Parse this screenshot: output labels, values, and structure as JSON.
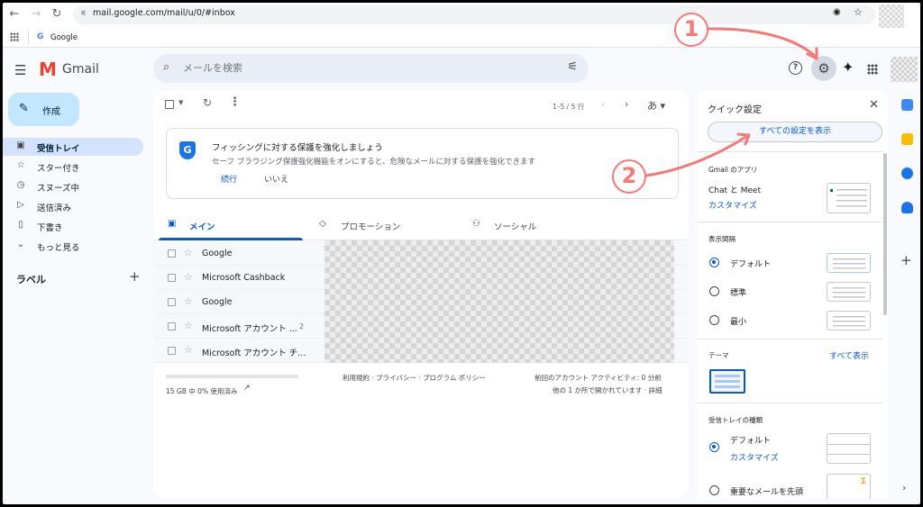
{
  "browser": {
    "url": "mail.google.com/mail/u/0/#inbox",
    "bookmark_label": "Google",
    "bookmark_icon_letter": "G"
  },
  "header": {
    "logo_letter": "M",
    "app_name": "Gmail",
    "search_placeholder": "メールを検索"
  },
  "nav": {
    "compose_label": "作成",
    "items": [
      {
        "label": "受信トレイ",
        "icon": "inbox-icon",
        "active": true
      },
      {
        "label": "スター付き",
        "icon": "star-icon"
      },
      {
        "label": "スヌーズ中",
        "icon": "clock-icon"
      },
      {
        "label": "送信済み",
        "icon": "send-icon"
      },
      {
        "label": "下書き",
        "icon": "draft-icon"
      },
      {
        "label": "もっと見る",
        "icon": "chevron-down-icon"
      }
    ],
    "labels_title": "ラベル"
  },
  "toolbar": {
    "page_count": "1–5 / 5 行",
    "ime_indicator": "あ"
  },
  "phishing_banner": {
    "title": "フィッシングに対する保護を強化しましょう",
    "body": "セーフ ブラウジング保護強化機能をオンにすると、危険なメールに対する保護を強化できます",
    "continue_label": "続行",
    "dismiss_label": "いいえ"
  },
  "tabs": [
    {
      "label": "メイン",
      "icon": "inbox-icon",
      "active": true
    },
    {
      "label": "プロモーション",
      "icon": "tag-icon"
    },
    {
      "label": "ソーシャル",
      "icon": "people-icon"
    }
  ],
  "emails": [
    {
      "sender": "Google",
      "count": ""
    },
    {
      "sender": "Microsoft Cashback",
      "count": ""
    },
    {
      "sender": "Google",
      "count": ""
    },
    {
      "sender": "Microsoft アカウント ...",
      "count": "2"
    },
    {
      "sender": "Microsoft アカウント チ...",
      "count": ""
    }
  ],
  "footer": {
    "storage": "15 GB 中 0% 使用済み",
    "links": "利用規約 · プライバシー · プログラム ポリシー",
    "activity_line1": "前回のアカウント アクティビティ: 0 分前",
    "activity_line2": "他の 1 か所で開かれています · 詳細"
  },
  "quick_settings": {
    "title": "クイック設定",
    "all_settings_button": "すべての設定を表示",
    "apps_section": "Gmail のアプリ",
    "chat_meet": "Chat と Meet",
    "customize": "カスタマイズ",
    "density_section": "表示間隔",
    "density_options": [
      "デフォルト",
      "標準",
      "最小"
    ],
    "theme_section": "テーマ",
    "theme_show_all": "すべて表示",
    "inbox_type_section": "受信トレイの種類",
    "inbox_default": "デフォルト",
    "inbox_customize": "カスタマイズ",
    "inbox_important_first": "重要なメールを先頭"
  },
  "annotations": {
    "step1": "1",
    "step2": "2",
    "color": "#f47a7a"
  },
  "colors": {
    "accent": "#0b57d0",
    "compose_bg": "#c2e7ff",
    "active_nav_bg": "#d3e3fd",
    "search_bg": "#e9eef6"
  }
}
